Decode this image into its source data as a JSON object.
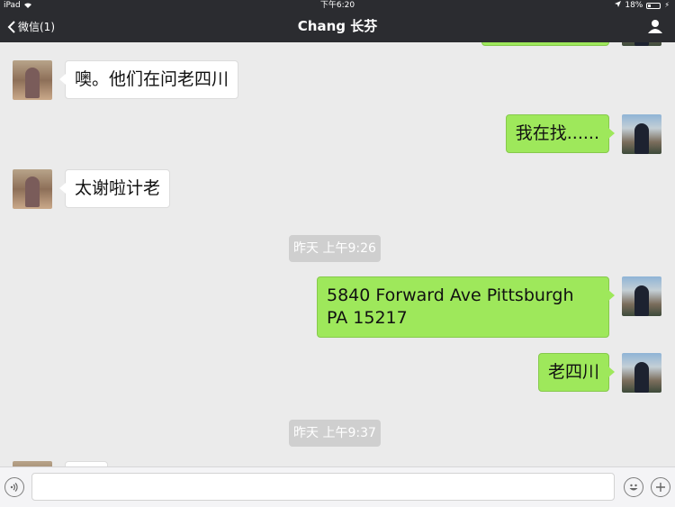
{
  "status_bar": {
    "device": "iPad",
    "time": "下午6:20",
    "battery": "18%"
  },
  "nav": {
    "back_label": "微信(1)",
    "title": "Chang 长芬"
  },
  "messages": [
    {
      "from": "her",
      "text": "噢。他们在问老四川"
    },
    {
      "from": "me",
      "text": "我在找......"
    },
    {
      "from": "her",
      "text": "太谢啦计老"
    },
    {
      "type": "time",
      "text": "昨天 上午9:26"
    },
    {
      "from": "me",
      "text": "5840 Forward Ave Pittsburgh PA 15217"
    },
    {
      "from": "me",
      "text": "老四川"
    },
    {
      "type": "time",
      "text": "昨天 上午9:37"
    }
  ],
  "input": {
    "value": "",
    "placeholder": ""
  },
  "colors": {
    "bar_bg": "#2b2c30",
    "chat_bg": "#ebebeb",
    "out_bubble": "#9ee85b",
    "in_bubble": "#ffffff"
  }
}
